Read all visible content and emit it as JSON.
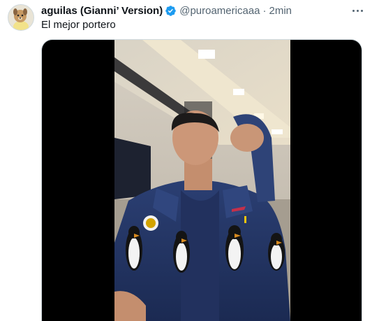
{
  "tweet": {
    "author_name": "aguilas (Gianni’ Version)",
    "handle": "@puroamericaaa",
    "separator": "·",
    "time": "2min",
    "text": "El mejor portero"
  },
  "icons": {
    "verified": "verified-badge-icon",
    "more": "more-options-icon"
  },
  "colors": {
    "verified": "#1d9bf0",
    "secondary_text": "#536471"
  }
}
